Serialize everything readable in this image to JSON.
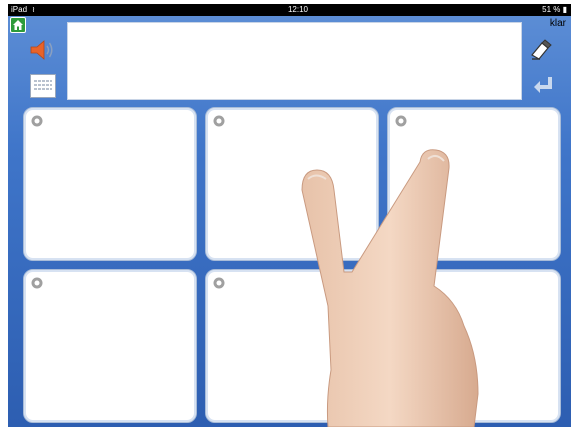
{
  "status_bar": {
    "carrier": "iPad",
    "time": "12:10",
    "battery": "51 %"
  },
  "toolbar": {
    "done_label": "klar"
  },
  "message_box": {
    "value": ""
  },
  "icons": {
    "home": "home-icon",
    "speaker": "speaker-icon",
    "keyboard": "keyboard-icon",
    "eraser": "eraser-icon",
    "enter": "enter-icon",
    "gear": "gear-icon"
  },
  "grid": {
    "rows": 2,
    "columns": 3,
    "cells": [
      {},
      {},
      {},
      {},
      {},
      {}
    ]
  },
  "colors": {
    "background_top": "#5e8fd6",
    "background_bottom": "#2d5eb1",
    "home": "#2e9b3a",
    "speaker": "#e8632a"
  }
}
